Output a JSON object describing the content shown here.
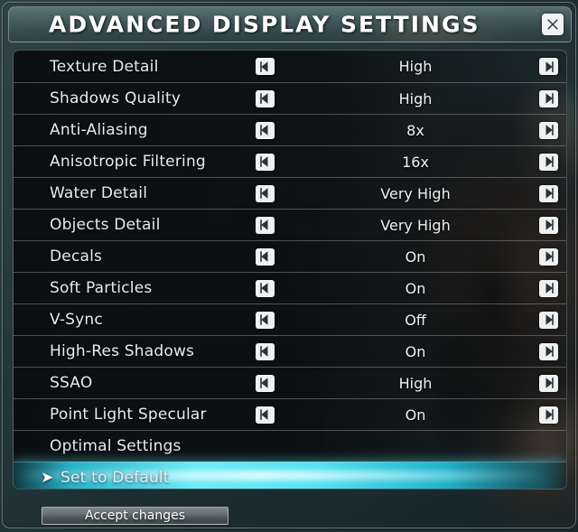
{
  "window": {
    "title": "ADVANCED DISPLAY SETTINGS",
    "close_icon": "close-x-icon",
    "accent_cyan": "#6eecf8",
    "title_bar_color": "#5e7a7c",
    "panel_bg": "#0a0d0e"
  },
  "controls": {
    "decrease_icon": "chevron-left-icon",
    "increase_icon": "chevron-right-icon",
    "selection_marker": "➤"
  },
  "settings": [
    {
      "label": "Texture Detail",
      "value": "High",
      "has_arrows": true
    },
    {
      "label": "Shadows Quality",
      "value": "High",
      "has_arrows": true
    },
    {
      "label": "Anti-Aliasing",
      "value": "8x",
      "has_arrows": true
    },
    {
      "label": "Anisotropic Filtering",
      "value": "16x",
      "has_arrows": true
    },
    {
      "label": "Water Detail",
      "value": "Very High",
      "has_arrows": true
    },
    {
      "label": "Objects Detail",
      "value": "Very High",
      "has_arrows": true
    },
    {
      "label": "Decals",
      "value": "On",
      "has_arrows": true
    },
    {
      "label": "Soft Particles",
      "value": "On",
      "has_arrows": true
    },
    {
      "label": "V-Sync",
      "value": "Off",
      "has_arrows": true
    },
    {
      "label": "High-Res Shadows",
      "value": "On",
      "has_arrows": true
    },
    {
      "label": "SSAO",
      "value": "High",
      "has_arrows": true
    },
    {
      "label": "Point Light Specular",
      "value": "On",
      "has_arrows": true
    },
    {
      "label": "Optimal Settings",
      "value": "",
      "has_arrows": false
    },
    {
      "label": "Set to Default",
      "value": "",
      "has_arrows": false,
      "selected": true
    }
  ],
  "footer": {
    "accept_label": "Accept changes"
  }
}
